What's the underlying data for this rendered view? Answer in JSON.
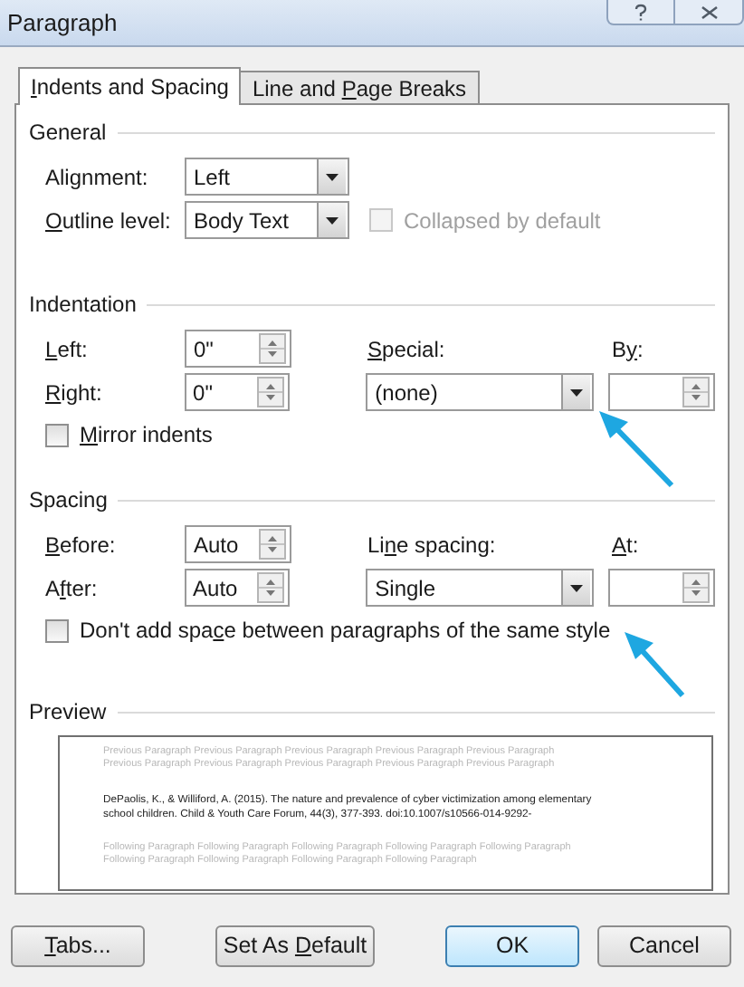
{
  "window": {
    "title": "Paragraph"
  },
  "tabs": [
    {
      "label": {
        "key": "I",
        "post": "ndents and Spacing"
      },
      "selected": true
    },
    {
      "label": {
        "pre": "Line and ",
        "key": "P",
        "post": "age Breaks"
      },
      "selected": false
    }
  ],
  "general": {
    "heading": "General",
    "alignment": {
      "label": {
        "pre": "Ali",
        "key": "g",
        "post": "nment:"
      },
      "value": "Left"
    },
    "outline_level": {
      "label": {
        "key": "O",
        "post": "utline level:"
      },
      "value": "Body Text"
    },
    "collapsed": {
      "label": {
        "pre": "Collapsed by default"
      },
      "checked": false,
      "disabled": true
    }
  },
  "indentation": {
    "heading": "Indentation",
    "left": {
      "label": {
        "key": "L",
        "post": "eft:"
      },
      "value": "0\""
    },
    "right": {
      "label": {
        "key": "R",
        "post": "ight:"
      },
      "value": "0\""
    },
    "special": {
      "label": {
        "key": "S",
        "post": "pecial:"
      },
      "value": "(none)"
    },
    "by": {
      "label": {
        "pre": "B",
        "key": "y",
        "post": ":"
      }
    },
    "mirror": {
      "label": {
        "key": "M",
        "post": "irror indents"
      },
      "checked": false,
      "disabled": false
    }
  },
  "spacing": {
    "heading": "Spacing",
    "before": {
      "label": {
        "key": "B",
        "post": "efore:"
      },
      "value": "Auto"
    },
    "after": {
      "label": {
        "pre": "A",
        "key": "f",
        "post": "ter:"
      },
      "value": "Auto"
    },
    "line_spacing": {
      "label": {
        "pre": "Li",
        "key": "n",
        "post": "e spacing:"
      },
      "value": "Single"
    },
    "at": {
      "label": {
        "key": "A",
        "post": "t:"
      }
    },
    "dont_add": {
      "label": {
        "pre": "Don't add spa",
        "key": "c",
        "post": "e between paragraphs of the same style"
      },
      "checked": false,
      "disabled": false
    }
  },
  "preview": {
    "heading": "Preview",
    "previous_lines": [
      "Previous Paragraph Previous Paragraph Previous Paragraph Previous Paragraph Previous Paragraph",
      "Previous Paragraph Previous Paragraph Previous Paragraph Previous Paragraph Previous Paragraph"
    ],
    "text_lines": [
      "DePaolis, K., & Williford, A. (2015). The nature and prevalence of cyber victimization among elementary",
      "school children. Child & Youth Care Forum, 44(3), 377-393. doi:10.1007/s10566-014-9292-"
    ],
    "following_lines": [
      "Following Paragraph Following Paragraph Following Paragraph Following Paragraph Following Paragraph",
      "Following Paragraph Following Paragraph Following Paragraph Following Paragraph"
    ]
  },
  "buttons": [
    {
      "label": {
        "key": "T",
        "post": "abs..."
      },
      "default": false
    },
    {
      "label": {
        "pre": "Set As ",
        "key": "D",
        "post": "efault"
      },
      "default": false
    },
    {
      "label": {
        "pre": "OK"
      },
      "default": true
    },
    {
      "label": {
        "pre": "Cancel"
      },
      "default": false
    }
  ]
}
